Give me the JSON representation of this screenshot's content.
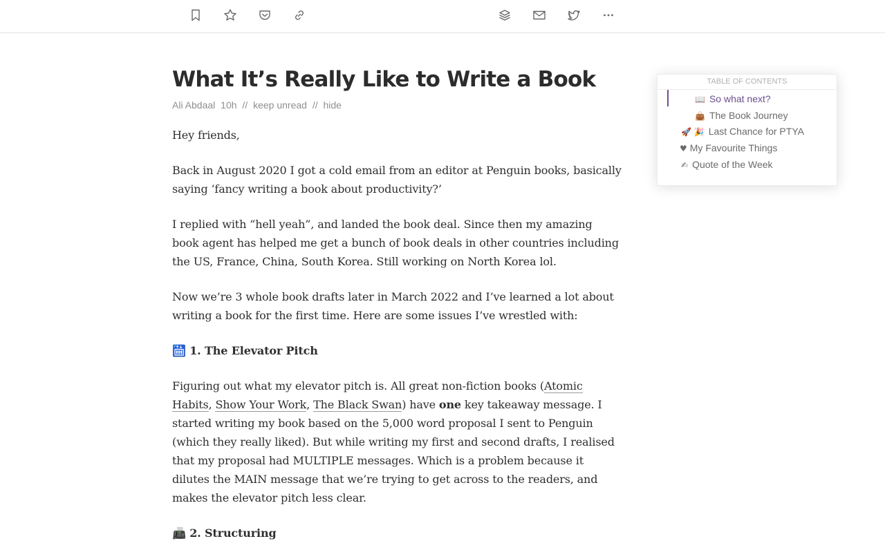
{
  "toolbar": {
    "left_icons": [
      "bookmark-icon",
      "star-icon",
      "pocket-icon",
      "link-icon"
    ],
    "right_icons": [
      "layers-icon",
      "mail-icon",
      "twitter-icon",
      "more-icon"
    ]
  },
  "article": {
    "title": "What It’s Really Like to Write a Book",
    "meta": {
      "author": "Ali Abdaal",
      "time": "10h",
      "sep": "//",
      "keep_unread": "keep unread",
      "hide": "hide"
    },
    "paragraphs": {
      "p1": "Hey friends,",
      "p2": "Back in August 2020 I got a cold email from an editor at Penguin books, basically saying ‘fancy writing a book about productivity?’",
      "p3": "I replied with “hell yeah”, and landed the book deal. Since then my amazing book agent has helped me get a bunch of book deals in other countries including the US, France, China, South Korea. Still working on North Korea lol.",
      "p4": "Now we’re 3 whole book drafts later in March 2022 and I’ve learned a lot about writing a book for the first time. Here are some issues I’ve wrestled with:",
      "h1_emoji": "🛗",
      "h1": "1. The Elevator Pitch",
      "p5_a": "Figuring out what my elevator pitch is. All great non-fiction books (",
      "link1": "Atomic Habits",
      "p5_b": ", ",
      "link2": "Show Your Work",
      "p5_c": ", ",
      "link3": "The Black Swan",
      "p5_d": ") have ",
      "p5_bold": "one",
      "p5_e": " key takeaway message. I started writing my book based on the 5,000 word proposal I sent to Penguin (which they really liked). But while writing my first and second drafts, I realised that my proposal had MULTIPLE messages. Which is a problem because it dilutes the MAIN message that we’re trying to get across to the readers, and makes the elevator pitch less clear.",
      "h2_emoji": "📠",
      "h2": "2. Structuring"
    }
  },
  "toc": {
    "title": "Table of Contents",
    "items": [
      {
        "emoji": "📖",
        "label": "So what next?"
      },
      {
        "emoji": "👜",
        "label": "The Book Journey"
      },
      {
        "emoji": "🚀 🎉",
        "label": "Last Chance for PTYA"
      },
      {
        "emoji": "♥",
        "label": "My Favourite Things"
      },
      {
        "emoji": "✍",
        "label": "Quote of the Week"
      }
    ]
  },
  "colors": {
    "accent": "#6b4f8f",
    "meta_text": "#8f8f8f"
  }
}
